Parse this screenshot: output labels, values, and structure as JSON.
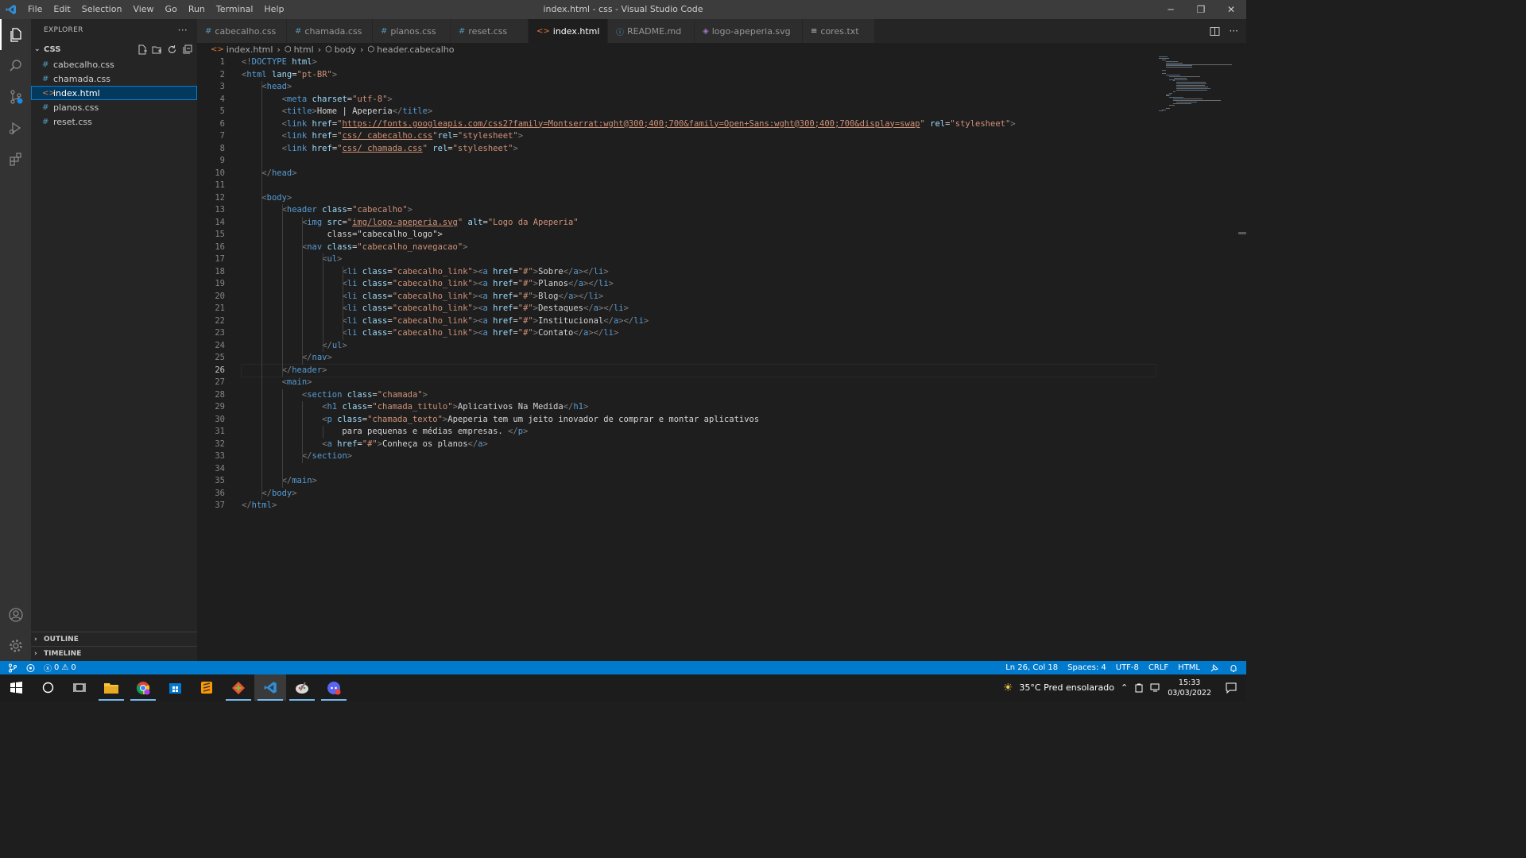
{
  "window": {
    "title": "index.html - css - Visual Studio Code",
    "menu": [
      "File",
      "Edit",
      "Selection",
      "View",
      "Go",
      "Run",
      "Terminal",
      "Help"
    ]
  },
  "sidebar": {
    "header": "EXPLORER",
    "folder": "CSS",
    "files": [
      {
        "name": "cabecalho.css",
        "type": "css",
        "icon": "#"
      },
      {
        "name": "chamada.css",
        "type": "css",
        "icon": "#"
      },
      {
        "name": "index.html",
        "type": "html",
        "icon": "<>",
        "selected": true
      },
      {
        "name": "planos.css",
        "type": "css",
        "icon": "#"
      },
      {
        "name": "reset.css",
        "type": "css",
        "icon": "#"
      }
    ],
    "outline_label": "OUTLINE",
    "timeline_label": "TIMELINE"
  },
  "tabs": [
    {
      "label": "cabecalho.css",
      "icon": "#",
      "kind": "css"
    },
    {
      "label": "chamada.css",
      "icon": "#",
      "kind": "css"
    },
    {
      "label": "planos.css",
      "icon": "#",
      "kind": "css"
    },
    {
      "label": "reset.css",
      "icon": "#",
      "kind": "css"
    },
    {
      "label": "index.html",
      "icon": "<>",
      "kind": "html",
      "active": true
    },
    {
      "label": "README.md",
      "icon": "ⓘ",
      "kind": "info"
    },
    {
      "label": "logo-apeperia.svg",
      "icon": "◈",
      "kind": "svg"
    },
    {
      "label": "cores.txt",
      "icon": "≡",
      "kind": "txt"
    }
  ],
  "breadcrumb": [
    "index.html",
    "html",
    "body",
    "header.cabecalho"
  ],
  "editor": {
    "current_line": 26,
    "lines": [
      "<!DOCTYPE html>",
      "<html lang=\"pt-BR\">",
      "    <head>",
      "        <meta charset=\"utf-8\">",
      "        <title>Home | Apeperia</title>",
      "        <link href=\"https://fonts.googleapis.com/css2?family=Montserrat:wght@300;400;700&family=Open+Sans:wght@300;400;700&display=swap\" rel=\"stylesheet\">",
      "        <link href=\"css/ cabecalho.css\"rel=\"stylesheet\">",
      "        <link href=\"css/ chamada.css\" rel=\"stylesheet\">",
      "",
      "    </head>",
      "",
      "    <body>",
      "        <header class=\"cabecalho\">",
      "            <img src=\"img/logo-apeperia.svg\" alt=\"Logo da Apeperia\"",
      "                 class=\"cabecalho_logo\">",
      "            <nav class=\"cabecalho_navegacao\">",
      "                <ul>",
      "                    <li class=\"cabecalho_link\"><a href=\"#\">Sobre</a></li>",
      "                    <li class=\"cabecalho_link\"><a href=\"#\">Planos</a></li>",
      "                    <li class=\"cabecalho_link\"><a href=\"#\">Blog</a></li>",
      "                    <li class=\"cabecalho_link\"><a href=\"#\">Destaques</a></li>",
      "                    <li class=\"cabecalho_link\"><a href=\"#\">Institucional</a></li>",
      "                    <li class=\"cabecalho_link\"><a href=\"#\">Contato</a></li>",
      "                </ul>",
      "            </nav>",
      "        </header>",
      "        <main>",
      "            <section class=\"chamada\">",
      "                <h1 class=\"chamada_titulo\">Aplicativos Na Medida</h1>",
      "                <p class=\"chamada_texto\">Apeperia tem um jeito inovador de comprar e montar aplicativos",
      "                    para pequenas e médias empresas. </p>",
      "                <a href=\"#\">Conheça os planos</a>",
      "            </section>",
      "",
      "        </main>",
      "    </body>",
      "</html>"
    ]
  },
  "statusbar": {
    "errors": "0",
    "warnings": "0",
    "position": "Ln 26, Col 18",
    "spaces": "Spaces: 4",
    "encoding": "UTF-8",
    "eol": "CRLF",
    "language": "HTML"
  },
  "taskbar": {
    "weather": "35°C  Pred ensolarado",
    "time": "15:33",
    "date": "03/03/2022"
  },
  "colors": {
    "accent": "#007acc",
    "tag": "#569cd6",
    "attribute": "#9cdcfe",
    "string": "#ce9178"
  }
}
